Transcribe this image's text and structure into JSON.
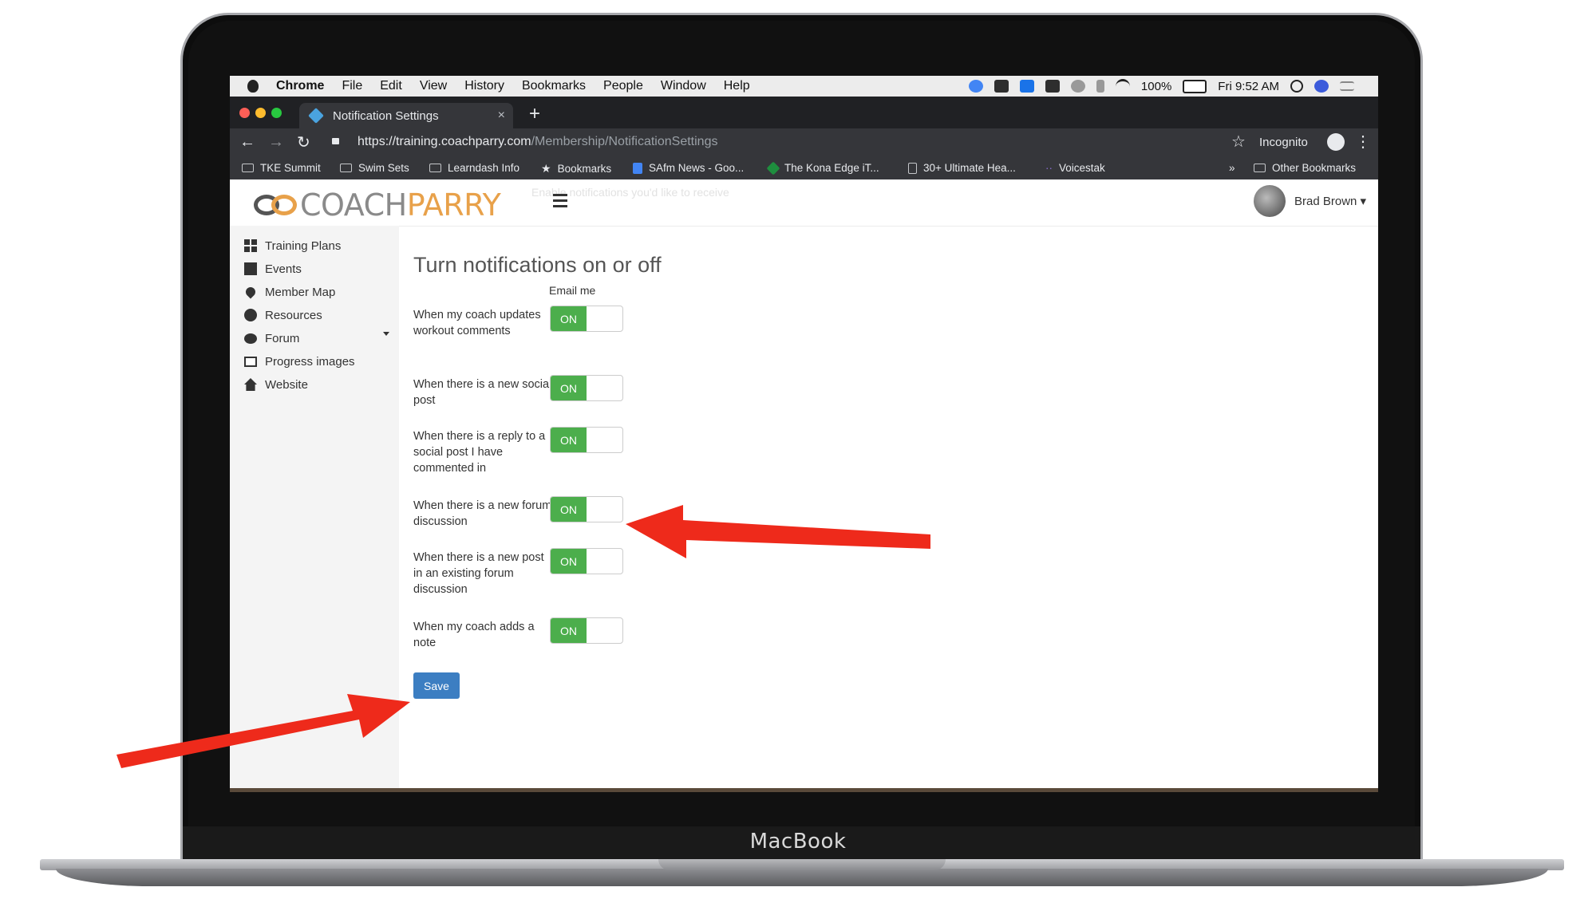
{
  "device": {
    "label": "MacBook"
  },
  "menubar": {
    "items": [
      "Chrome",
      "File",
      "Edit",
      "View",
      "History",
      "Bookmarks",
      "People",
      "Window",
      "Help"
    ],
    "battery": "100%",
    "clock": "Fri 9:52 AM"
  },
  "browser": {
    "tab_title": "Notification Settings",
    "tab_close": "×",
    "new_tab": "+",
    "url_host": "https://training.coachparry.com",
    "url_path": "/Membership/NotificationSettings",
    "incognito_label": "Incognito",
    "bookmarks": [
      "TKE Summit",
      "Swim Sets",
      "Learndash Info",
      "Bookmarks",
      "SAfm News - Goo...",
      "The Kona Edge iT...",
      "30+ Ultimate Hea...",
      "Voicestak"
    ],
    "bookmarks_overflow": "»",
    "other_bookmarks": "Other Bookmarks"
  },
  "app": {
    "logo_coach": "COACH",
    "logo_parry": "PARRY",
    "ghost_text": "Enable notifications you'd like to receive",
    "user_name": "Brad Brown",
    "sidebar": [
      {
        "label": "Training Plans",
        "icon": "grid-icon"
      },
      {
        "label": "Events",
        "icon": "calendar-icon"
      },
      {
        "label": "Member Map",
        "icon": "map-pin-icon"
      },
      {
        "label": "Resources",
        "icon": "gears-icon"
      },
      {
        "label": "Forum",
        "icon": "chat-icon"
      },
      {
        "label": "Progress images",
        "icon": "image-icon"
      },
      {
        "label": "Website",
        "icon": "home-icon"
      }
    ],
    "page_title": "Turn notifications on or off",
    "column_header": "Email me",
    "rows": [
      {
        "label": "When my coach updates workout comments",
        "state": "ON"
      },
      {
        "label": "When there is a new social post",
        "state": "ON"
      },
      {
        "label": "When there is a reply to a social post I have commented in",
        "state": "ON"
      },
      {
        "label": "When there is a new forum discussion",
        "state": "ON"
      },
      {
        "label": "When there is a new post in an existing forum discussion",
        "state": "ON"
      },
      {
        "label": "When my coach adds a note",
        "state": "ON"
      }
    ],
    "save_label": "Save"
  },
  "colors": {
    "toggle_on": "#4cae4c",
    "save_button": "#3c7ec2",
    "annotation_arrow": "#ee2a1b",
    "logo_accent": "#e8a14a"
  }
}
